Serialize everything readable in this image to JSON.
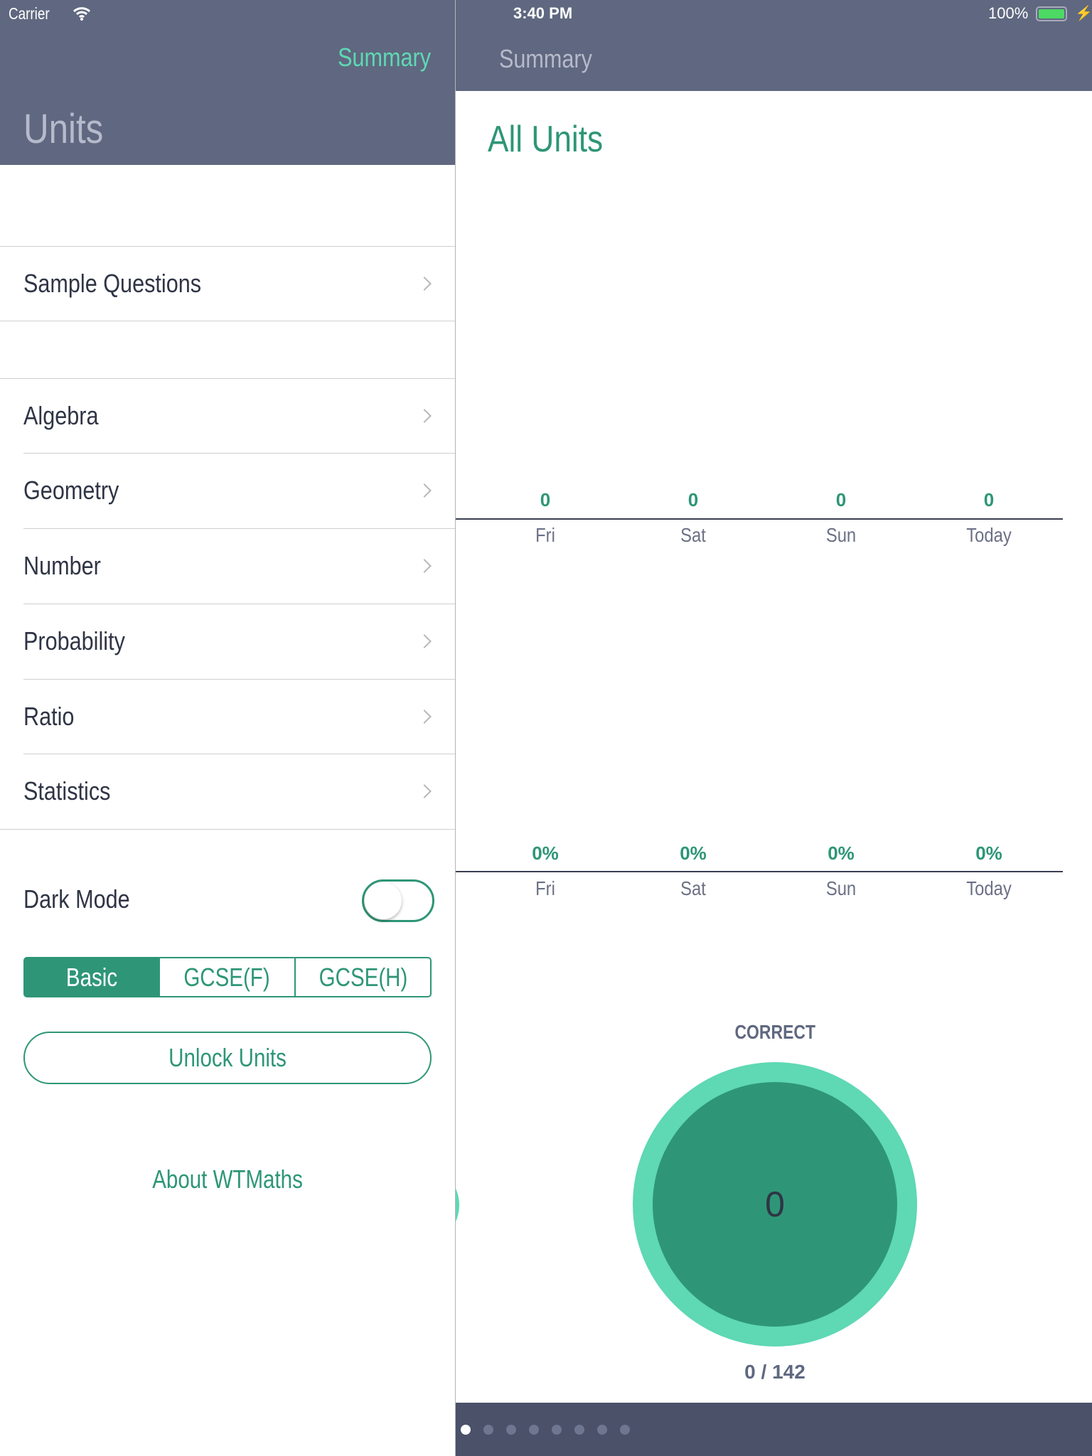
{
  "status_bar": {
    "carrier": "Carrier",
    "time": "3:40 PM",
    "battery": "100%"
  },
  "left": {
    "nav_button": "Summary",
    "title": "Units",
    "sample": "Sample Questions",
    "units": [
      "Algebra",
      "Geometry",
      "Number",
      "Probability",
      "Ratio",
      "Statistics"
    ],
    "dark_mode_label": "Dark Mode",
    "dark_mode_on": false,
    "segments": [
      "Basic",
      "GCSE(F)",
      "GCSE(H)"
    ],
    "selected_segment": "Basic",
    "unlock": "Unlock Units",
    "about": "About WTMaths"
  },
  "right": {
    "nav_title": "Summary",
    "title": "All Units",
    "chart_data": [
      {
        "type": "bar",
        "categories": [
          "Fri",
          "Sat",
          "Sun",
          "Today"
        ],
        "values": [
          0,
          0,
          0,
          0
        ],
        "labels": [
          "0",
          "0",
          "0",
          "0"
        ]
      },
      {
        "type": "bar",
        "categories": [
          "Fri",
          "Sat",
          "Sun",
          "Today"
        ],
        "values": [
          0,
          0,
          0,
          0
        ],
        "labels": [
          "0%",
          "0%",
          "0%",
          "0%"
        ]
      }
    ],
    "correct_label": "CORRECT",
    "correct_value": "0",
    "correct_fraction": "0 / 142",
    "page_count": 8,
    "current_page": 1
  },
  "colors": {
    "header": "#5f6880",
    "accent": "#2e9677",
    "accent_light": "#5fd8b4",
    "footer": "#4a5169"
  }
}
